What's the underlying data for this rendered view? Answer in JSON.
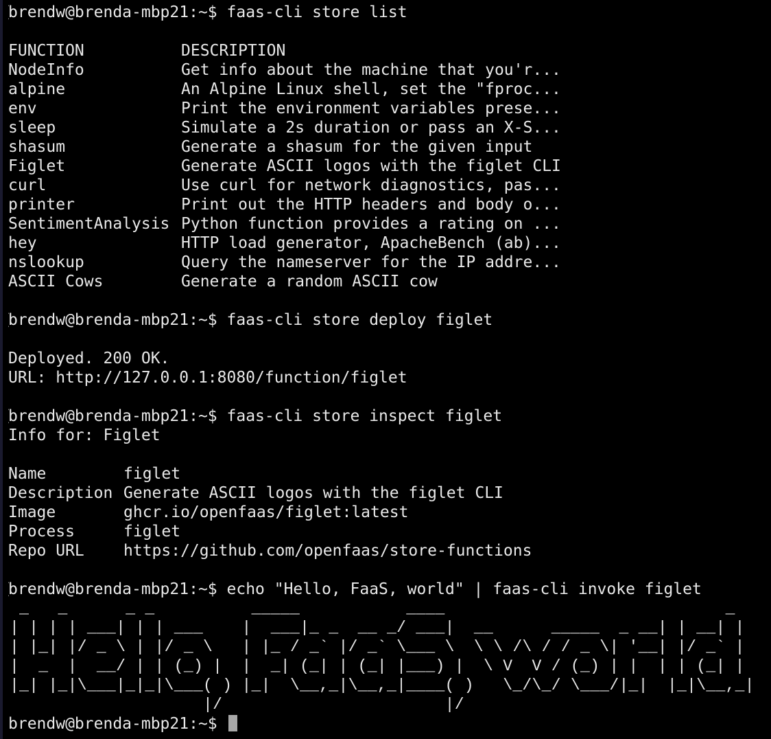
{
  "terminal": {
    "prompt": "brendw@brenda-mbp21:~$",
    "block1": {
      "command": "faas-cli store list",
      "header": {
        "name": "FUNCTION",
        "desc": "DESCRIPTION"
      },
      "rows": [
        {
          "name": "NodeInfo",
          "desc": "Get info about the machine that you'r..."
        },
        {
          "name": "alpine",
          "desc": "An Alpine Linux shell, set the \"fproc..."
        },
        {
          "name": "env",
          "desc": "Print the environment variables prese..."
        },
        {
          "name": "sleep",
          "desc": "Simulate a 2s duration or pass an X-S..."
        },
        {
          "name": "shasum",
          "desc": "Generate a shasum for the given input"
        },
        {
          "name": "Figlet",
          "desc": "Generate ASCII logos with the figlet CLI"
        },
        {
          "name": "curl",
          "desc": "Use curl for network diagnostics, pas..."
        },
        {
          "name": "printer",
          "desc": "Print out the HTTP headers and body o..."
        },
        {
          "name": "SentimentAnalysis",
          "desc": "Python function provides a rating on ..."
        },
        {
          "name": "hey",
          "desc": "HTTP load generator, ApacheBench (ab)..."
        },
        {
          "name": "nslookup",
          "desc": "Query the nameserver for the IP addre..."
        },
        {
          "name": "ASCII Cows",
          "desc": "Generate a random ASCII cow"
        }
      ]
    },
    "block2": {
      "command": "faas-cli store deploy figlet",
      "output1": "Deployed. 200 OK.",
      "output2": "URL: http://127.0.0.1:8080/function/figlet"
    },
    "block3": {
      "command": "faas-cli store inspect figlet",
      "info_header": "Info for: Figlet",
      "fields": [
        {
          "key": "Name",
          "value": "figlet"
        },
        {
          "key": "Description",
          "value": "Generate ASCII logos with the figlet CLI"
        },
        {
          "key": "Image",
          "value": "ghcr.io/openfaas/figlet:latest"
        },
        {
          "key": "Process",
          "value": "figlet"
        },
        {
          "key": "Repo URL",
          "value": "https://github.com/openfaas/store-functions"
        }
      ]
    },
    "block4": {
      "command": "echo \"Hello, FaaS, world\" | faas-cli invoke figlet",
      "ascii_art": " _   _      _ _          _____           ____                             _     _ \n| | | | ___| | | ___    |  ___|_ _  __ _/ ___|  __      _____  _ __| | __| |\n| |_| |/ _ \\ | |/ _ \\   | |_ / _` |/ _` \\___ \\  \\ \\ /\\ / / _ \\| '__| |/ _` |\n|  _  |  __/ | | (_) |  |  _| (_| | (_| |___) |  \\ V  V / (_) | |  | | (_| |\n|_| |_|\\___|_|_|\\___( ) |_|  \\__,_|\\__,_|____( )   \\_/\\_/ \\___/|_|  |_|\\__,_|\n                    |/                       |/                             "
    }
  }
}
